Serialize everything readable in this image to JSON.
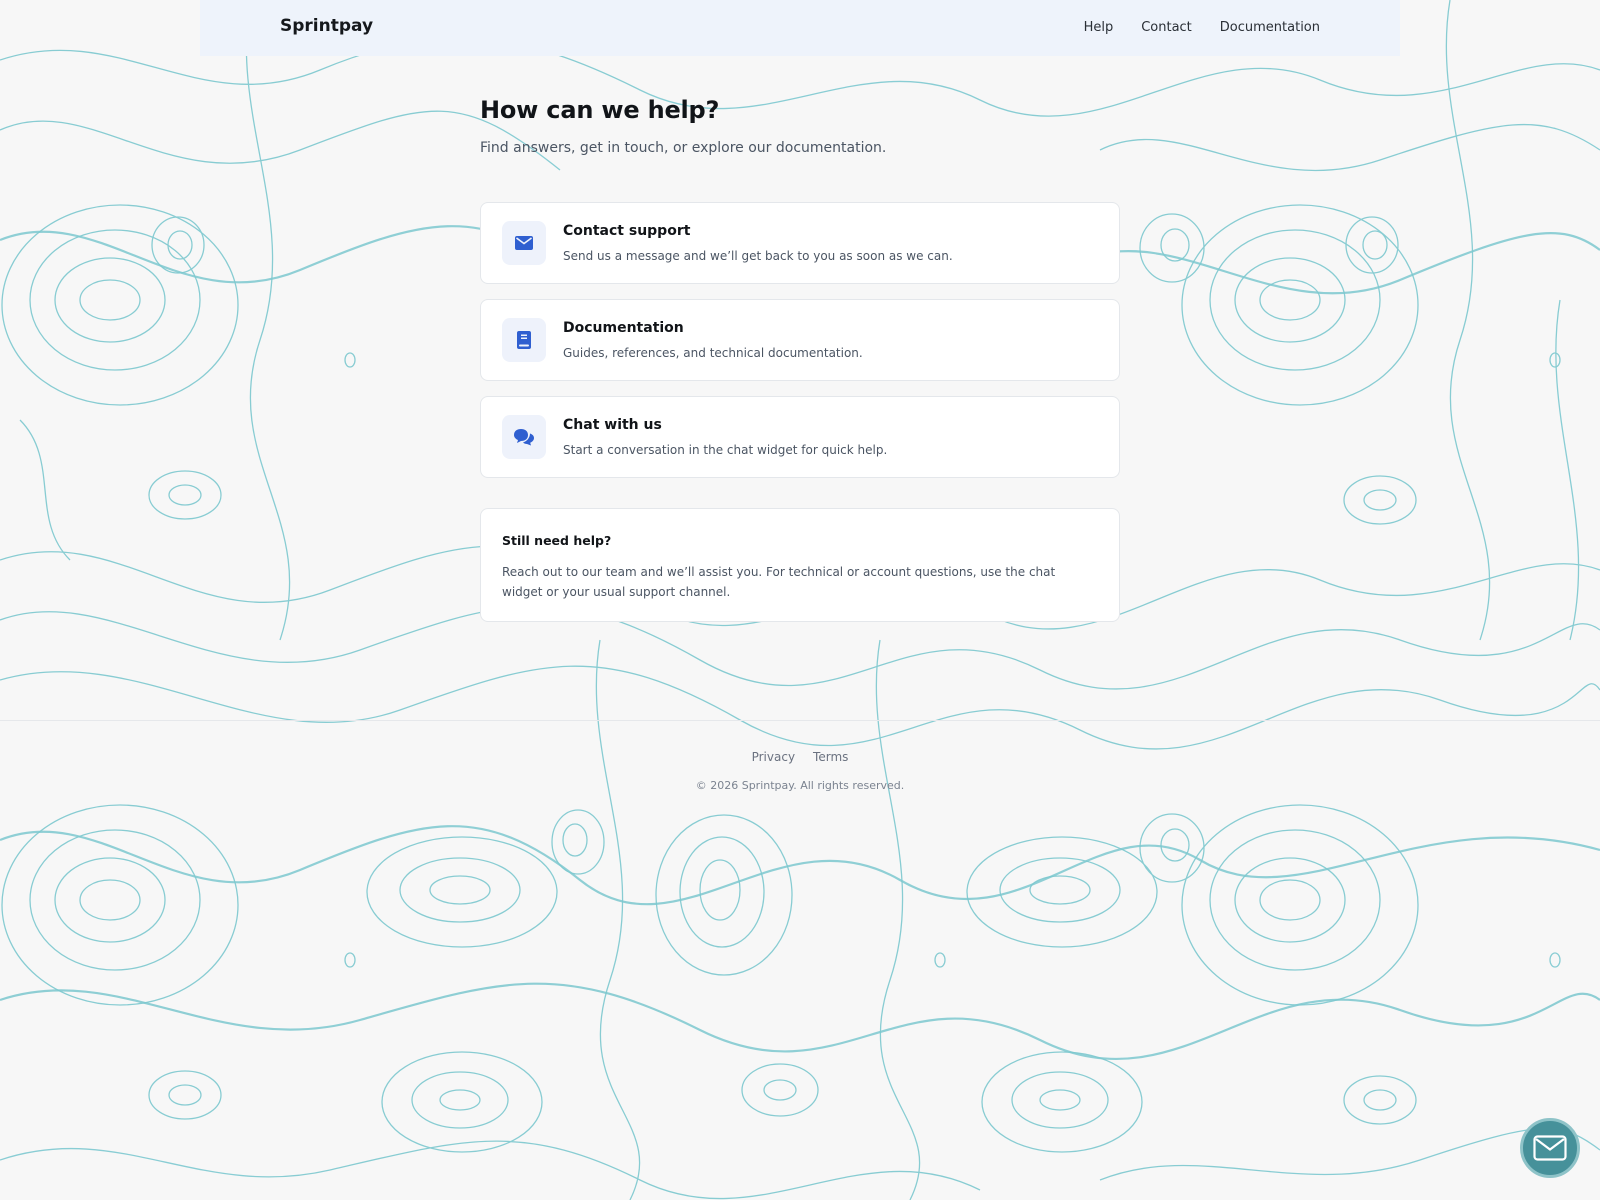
{
  "nav": {
    "brand": "Sprintpay",
    "links": [
      "Help",
      "Contact",
      "Documentation"
    ]
  },
  "main": {
    "title": "How can we help?",
    "subtitle": "Find answers, get in touch, or explore our documentation.",
    "cards": [
      {
        "icon": "envelope-icon",
        "title": "Contact support",
        "description": "Send us a message and we’ll get back to you as soon as we can."
      },
      {
        "icon": "book-icon",
        "title": "Documentation",
        "description": "Guides, references, and technical documentation."
      },
      {
        "icon": "chat-bubbles-icon",
        "title": "Chat with us",
        "description": "Start a conversation in the chat widget for quick help."
      }
    ],
    "help_box": {
      "title": "Still need help?",
      "body": "Reach out to our team and we’ll assist you. For technical or account questions, use the chat widget or your usual support channel."
    }
  },
  "footer": {
    "links": [
      "Privacy",
      "Terms"
    ],
    "copyright": "© 2026 Sprintpay. All rights reserved."
  },
  "chat_widget": {
    "icon": "mail-icon"
  },
  "colors": {
    "accent": "#2f5fd0",
    "contour": "#7cc8cf",
    "header_bg": "#eef3fb",
    "fab_bg": "#46919a"
  }
}
